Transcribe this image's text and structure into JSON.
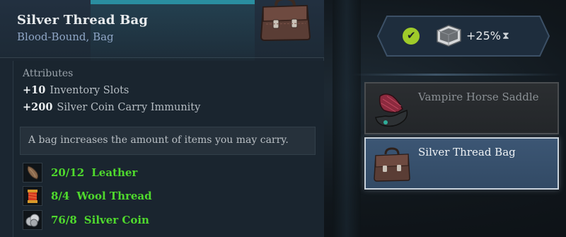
{
  "tooltip": {
    "title": "Silver Thread Bag",
    "subtitle": "Blood-Bound, Bag",
    "item_icon": "bag-icon",
    "attributes": {
      "header": "Attributes",
      "lines": [
        {
          "value": "+10",
          "text": "Inventory Slots"
        },
        {
          "value": "+200",
          "text": "Silver Coin Carry Immunity"
        }
      ]
    },
    "description": "A bag increases the amount of items you may carry.",
    "requirements": [
      {
        "count": "20/12",
        "name": "Leather",
        "icon": "leather-icon"
      },
      {
        "count": "8/4",
        "name": "Wool Thread",
        "icon": "wool-thread-icon"
      },
      {
        "count": "76/8",
        "name": "Silver Coin",
        "icon": "silver-coin-icon"
      }
    ],
    "requirement_color": "#4fd92d"
  },
  "bonus": {
    "status_icon": "check-icon",
    "icon": "crate-icon",
    "text": "+25%",
    "time_icon": "hourglass-icon"
  },
  "recipes": [
    {
      "label": "Vampire Horse Saddle",
      "icon": "saddle-icon",
      "selected": false
    },
    {
      "label": "Silver Thread Bag",
      "icon": "bag-icon",
      "selected": true
    }
  ],
  "colors": {
    "accent": "#2a8ea0",
    "check": "#9fcb2a",
    "selected_card": "#3c5674"
  }
}
